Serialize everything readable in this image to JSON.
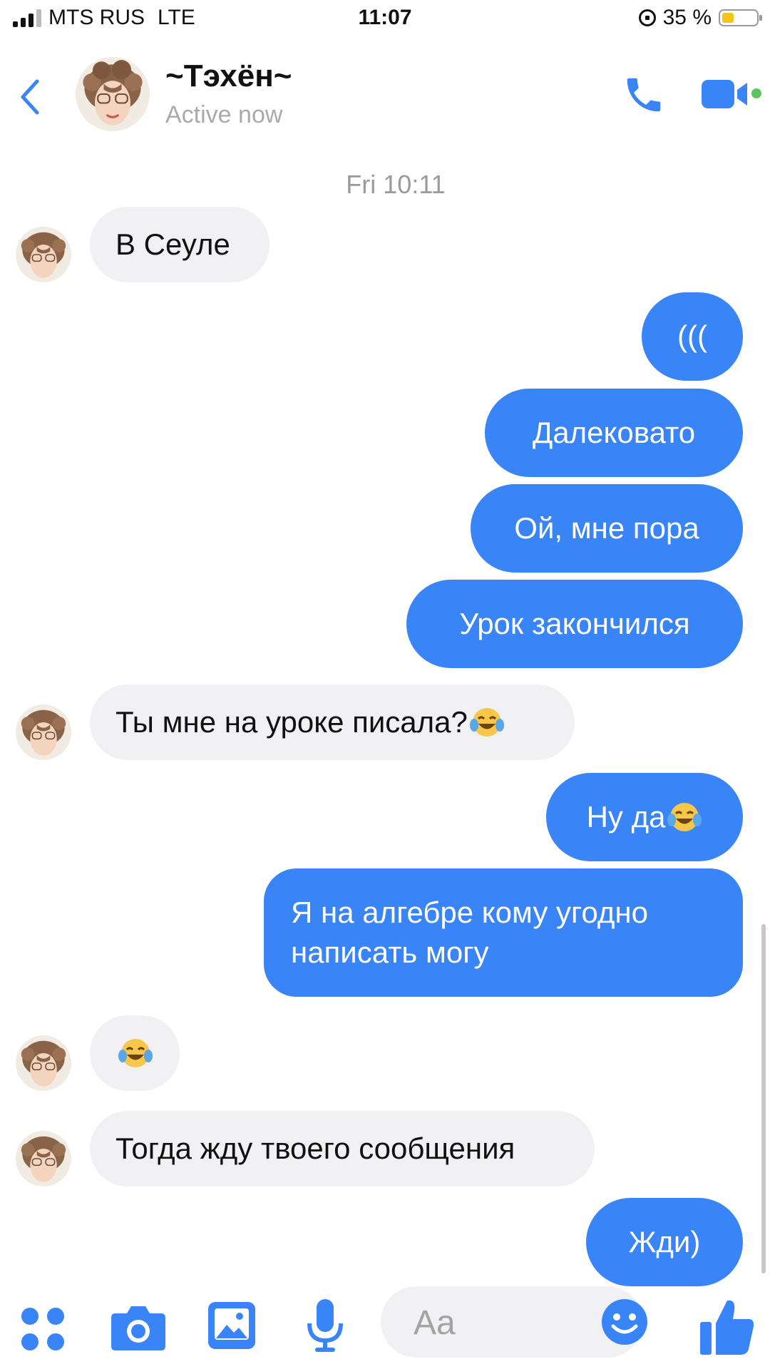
{
  "status": {
    "carrier": "MTS RUS",
    "network": "LTE",
    "time": "11:07",
    "battery_text": "35 %",
    "battery_level": 0.35
  },
  "header": {
    "contact_name": "~Тэхён~",
    "presence": "Active now",
    "icons": [
      "back-chevron-icon",
      "phone-icon",
      "video-camera-icon"
    ],
    "accent": "#3984f6"
  },
  "thread": {
    "date_separator": "Fri 10:11",
    "messages": [
      {
        "from": "them",
        "text": "В Сеуле"
      },
      {
        "from": "me",
        "text": "((("
      },
      {
        "from": "me",
        "text": "Далековато"
      },
      {
        "from": "me",
        "text": "Ой, мне пора"
      },
      {
        "from": "me",
        "text": "Урок закончился"
      },
      {
        "from": "them",
        "text": "Ты мне на уроке писала?",
        "emoji": "tears-of-joy"
      },
      {
        "from": "me",
        "text": "Ну да",
        "emoji": "tears-of-joy"
      },
      {
        "from": "me",
        "text": "Я на алгебре кому угодно написать могу"
      },
      {
        "from": "them",
        "text": "",
        "emoji": "tears-of-joy"
      },
      {
        "from": "them",
        "text": "Тогда жду твоего сообщения"
      },
      {
        "from": "me",
        "text": "Жди)"
      }
    ]
  },
  "composer": {
    "placeholder": "Aa",
    "icons": [
      "apps-grid-icon",
      "camera-icon",
      "gallery-icon",
      "microphone-icon",
      "smiley-icon",
      "thumbs-up-icon"
    ]
  },
  "colors": {
    "outgoing_bubble": "#3984f6",
    "incoming_bubble": "#f1f1f3"
  }
}
